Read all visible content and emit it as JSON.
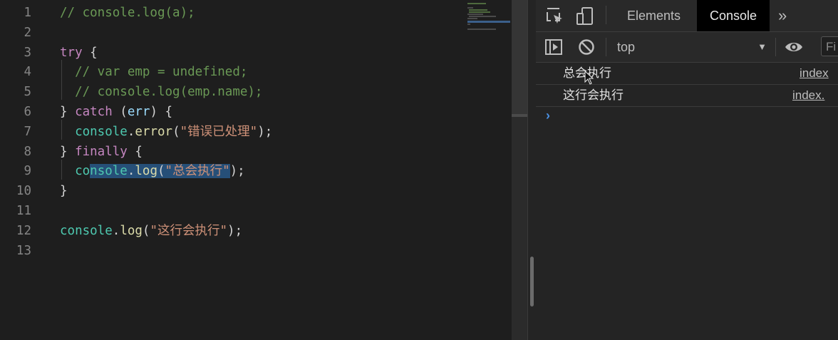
{
  "editor": {
    "lines": [
      {
        "num": "1",
        "tokens": [
          {
            "t": "// console.log(a);",
            "c": "t-comment"
          }
        ]
      },
      {
        "num": "2",
        "tokens": []
      },
      {
        "num": "3",
        "tokens": [
          {
            "t": "try",
            "c": "t-keyword"
          },
          {
            "t": " {",
            "c": "t-punc"
          }
        ]
      },
      {
        "num": "4",
        "tokens": [
          {
            "t": "  // var emp = undefined;",
            "c": "t-comment"
          }
        ]
      },
      {
        "num": "5",
        "tokens": [
          {
            "t": "  // console.log(emp.name);",
            "c": "t-comment"
          }
        ]
      },
      {
        "num": "6",
        "tokens": [
          {
            "t": "} ",
            "c": "t-punc"
          },
          {
            "t": "catch",
            "c": "t-keyword"
          },
          {
            "t": " (",
            "c": "t-punc"
          },
          {
            "t": "err",
            "c": "t-var"
          },
          {
            "t": ") {",
            "c": "t-punc"
          }
        ]
      },
      {
        "num": "7",
        "tokens": [
          {
            "t": "  ",
            "c": "t-punc"
          },
          {
            "t": "console",
            "c": "t-obj"
          },
          {
            "t": ".",
            "c": "t-punc"
          },
          {
            "t": "error",
            "c": "t-func"
          },
          {
            "t": "(",
            "c": "t-punc"
          },
          {
            "t": "\"错误已处理\"",
            "c": "t-str"
          },
          {
            "t": ");",
            "c": "t-punc"
          }
        ]
      },
      {
        "num": "8",
        "tokens": [
          {
            "t": "} ",
            "c": "t-punc"
          },
          {
            "t": "finally",
            "c": "t-keyword"
          },
          {
            "t": " {",
            "c": "t-punc"
          }
        ]
      },
      {
        "num": "9",
        "tokens": [
          {
            "t": "  co",
            "c": "t-obj"
          },
          {
            "t": "nsole",
            "c": "t-obj sel"
          },
          {
            "t": ".",
            "c": "t-punc sel"
          },
          {
            "t": "log",
            "c": "t-func sel"
          },
          {
            "t": "(",
            "c": "t-punc sel"
          },
          {
            "t": "\"总会执行\"",
            "c": "t-str sel"
          },
          {
            "t": ");",
            "c": "t-punc"
          }
        ]
      },
      {
        "num": "10",
        "tokens": [
          {
            "t": "}",
            "c": "t-punc"
          }
        ]
      },
      {
        "num": "11",
        "tokens": []
      },
      {
        "num": "12",
        "tokens": [
          {
            "t": "console",
            "c": "t-obj"
          },
          {
            "t": ".",
            "c": "t-punc"
          },
          {
            "t": "log",
            "c": "t-func"
          },
          {
            "t": "(",
            "c": "t-punc"
          },
          {
            "t": "\"这行会执行\"",
            "c": "t-str"
          },
          {
            "t": ");",
            "c": "t-punc"
          }
        ]
      },
      {
        "num": "13",
        "tokens": []
      }
    ]
  },
  "devtools": {
    "tabs": [
      {
        "label": "Elements",
        "active": false
      },
      {
        "label": "Console",
        "active": true
      }
    ],
    "more_tabs": "»",
    "context": "top",
    "filter_placeholder": "Fi",
    "messages": [
      {
        "text": "总会执行",
        "source": "index"
      },
      {
        "text": "这行会执行",
        "source": "index."
      }
    ],
    "prompt": "›"
  }
}
